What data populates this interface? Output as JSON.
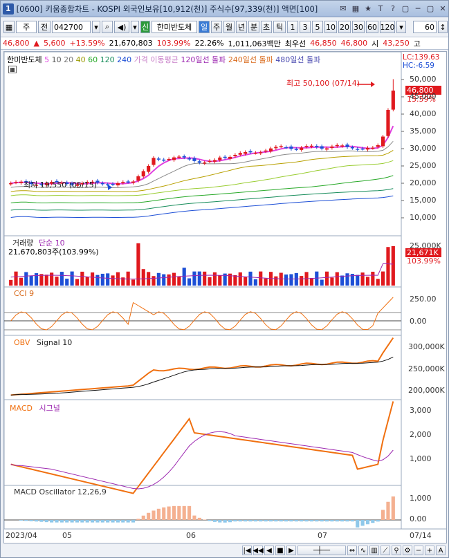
{
  "window": {
    "number": "1",
    "title": "[0600] 키움종합차트 - KOSPI 외국인보유[10,912(천)] 주식수[97,339(천)] 액면[100]",
    "controls": [
      "✉",
      "▦",
      "★",
      "T",
      "?",
      "▢",
      "─",
      "▢",
      "✕"
    ]
  },
  "toolbar": {
    "market": "주",
    "prev": "전",
    "code": "042700",
    "new_label": "신",
    "stock_name": "한미반도체",
    "periods": [
      "일",
      "주",
      "월",
      "년",
      "분",
      "초",
      "틱"
    ],
    "active_period": "일",
    "intervals": [
      "1",
      "3",
      "5",
      "10",
      "20",
      "30",
      "60",
      "120"
    ],
    "count": "60"
  },
  "quote": {
    "price": "46,800",
    "change_arrow": "▲",
    "change": "5,600",
    "change_pct": "+13.59%",
    "volume": "21,670,803",
    "vol_ratio": "103.99%",
    "turnover": "22.26%",
    "amount": "1,011,063백만",
    "best_ask_label": "최우선",
    "best_ask": "46,850",
    "best_bid": "46,800",
    "open_label": "시",
    "open": "43,250",
    "high_label": "고"
  },
  "price_panel": {
    "name": "한미반도체",
    "ma_labels": [
      "5",
      "10",
      "20",
      "40",
      "60",
      "120",
      "240"
    ],
    "ma_title": "가격 이동평균",
    "break_120": "120일선 돌파",
    "break_240": "240일선 돌파",
    "break_480": "480일선 돌파",
    "lc": "LC:139.63",
    "hc": "HC:-6.59",
    "max_label": "최고 50,100 (07/14)",
    "min_label": "최저 19,550 (05/15)",
    "last_price": "46,800",
    "last_pct": "13.59%",
    "y_ticks": [
      "50,000",
      "45,000",
      "40,000",
      "35,000",
      "30,000",
      "25,000",
      "20,000",
      "15,000",
      "10,000"
    ]
  },
  "volume_panel": {
    "title": "거래량",
    "sub": "단순 10",
    "info": "21,670,803주(103.99%)",
    "y_ticks": [
      "25,000K"
    ],
    "last": "21,671K",
    "last_pct": "103.99%"
  },
  "cci_panel": {
    "title": "CCI 9",
    "y_ticks": [
      "250.00",
      "0.00"
    ]
  },
  "obv_panel": {
    "title": "OBV",
    "signal": "Signal 10",
    "y_ticks": [
      "300,000K",
      "250,000K",
      "200,000K"
    ]
  },
  "macd_panel": {
    "title": "MACD",
    "signal": "시그널",
    "y_ticks": [
      "3,000",
      "2,000",
      "1,000"
    ]
  },
  "osc_panel": {
    "title": "MACD Oscillator 12,26,9",
    "y_ticks": [
      "1,000",
      "0.00"
    ]
  },
  "x_axis": {
    "labels": [
      "2023/04",
      "05",
      "06",
      "07"
    ],
    "right_label": "07/14"
  },
  "colors": {
    "up": "#e0191e",
    "down": "#1d4fd6",
    "ma5": "#e040e0",
    "obv": "#f07010"
  },
  "chart_data": {
    "type": "candlestick",
    "x_labels": [
      "2023/04",
      "05",
      "06",
      "07"
    ],
    "ylim": [
      10000,
      50000
    ],
    "series_samples": {
      "close_start": 20000,
      "close_mid_may": 19550,
      "close_end_june": 27000,
      "close_early_july": 30000,
      "close_last": 46800,
      "high_last": 50100
    }
  }
}
